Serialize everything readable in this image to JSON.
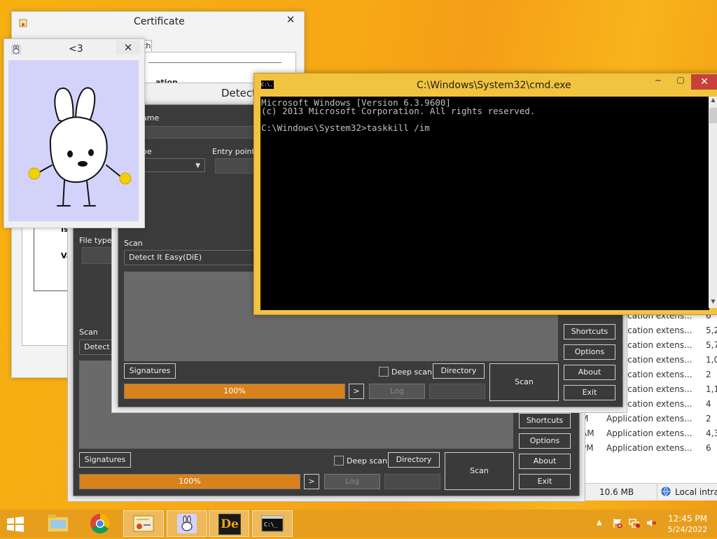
{
  "certificate": {
    "title": "Certificate",
    "tab_partial": "th",
    "text_fragment_1": "ation",
    "text_fragment_2": "Is",
    "text_fragment_3": "Va"
  },
  "cute_window": {
    "title": "<3"
  },
  "die_back": {
    "labels": {
      "file_type": "File type",
      "scan": "Scan"
    },
    "scan_engine": "Detect I",
    "buttons": {
      "signatures": "Signatures",
      "directory": "Directory",
      "scan": "Scan",
      "log": "Log",
      "arrow": ">",
      "shortcuts": "Shortcuts",
      "options": "Options",
      "about": "About",
      "exit": "Exit"
    },
    "deep_scan": "Deep scan",
    "progress_text": "100%",
    "progress": 1.0
  },
  "die_front": {
    "title": "Detect",
    "labels": {
      "name": "ame",
      "type": "pe",
      "entry_point": "Entry point",
      "scan": "Scan"
    },
    "scan_engine": "Detect It Easy(DiE)",
    "buttons": {
      "signatures": "Signatures",
      "directory": "Directory",
      "scan": "Scan",
      "log": "Log",
      "arrow": ">",
      "shortcuts": "Shortcuts",
      "options": "Options",
      "about": "About",
      "exit": "Exit"
    },
    "deep_scan": "Deep scan",
    "progress_text": "100%",
    "progress": 1.0
  },
  "cmd": {
    "title": "C:\\Windows\\System32\\cmd.exe",
    "icon_text": "C:\\.",
    "lines": [
      "Microsoft Windows [Version 6.3.9600]",
      "(c) 2013 Microsoft Corporation. All rights reserved.",
      "",
      "C:\\Windows\\System32>taskkill /im"
    ]
  },
  "task_manager": {
    "rows": [
      {
        "time": "",
        "desc": "Application extens...",
        "val": "6"
      },
      {
        "time": "",
        "desc": "Application extens...",
        "val": "5,2"
      },
      {
        "time": "",
        "desc": "Application extens...",
        "val": "5,7"
      },
      {
        "time": "",
        "desc": "Application extens...",
        "val": "1,0"
      },
      {
        "time": "",
        "desc": "Application extens...",
        "val": "2"
      },
      {
        "time": "",
        "desc": "Application extens...",
        "val": "1,1"
      },
      {
        "time": "M",
        "desc": "Application extens...",
        "val": "4"
      },
      {
        "time": "M",
        "desc": "Application extens...",
        "val": "2"
      },
      {
        "time": "AM",
        "desc": "Application extens...",
        "val": "4,3"
      },
      {
        "time": "PM",
        "desc": "Application extens...",
        "val": "6"
      }
    ],
    "status_size": "10.6 MB",
    "status_zone": "Local intrar"
  },
  "taskbar": {
    "time": "12:45 PM",
    "date": "5/24/2022",
    "die_icon_text": "De"
  }
}
